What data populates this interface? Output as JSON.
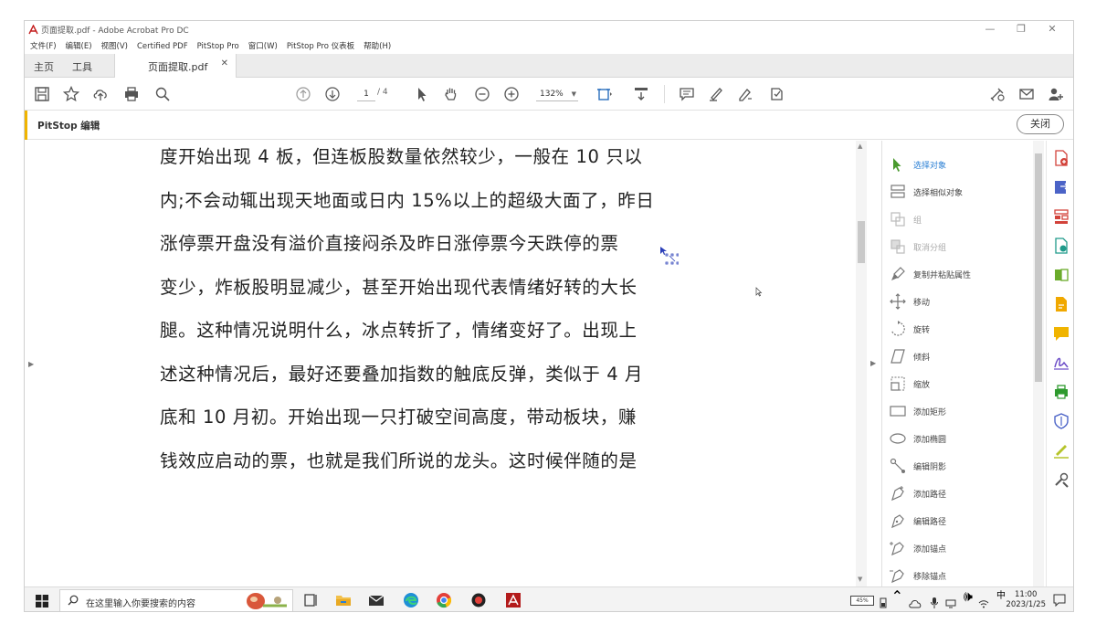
{
  "window": {
    "title": "页面提取.pdf - Adobe Acrobat Pro DC",
    "controls": [
      "—",
      "❐",
      "✕"
    ]
  },
  "menubar": [
    "文件(F)",
    "编辑(E)",
    "视图(V)",
    "Certified PDF",
    "PitStop Pro",
    "窗口(W)",
    "PitStop Pro 仪表板",
    "帮助(H)"
  ],
  "tabs": {
    "home": "主页",
    "tools": "工具",
    "document": "页面提取.pdf",
    "close": "✕"
  },
  "toolbar": {
    "page_current": "1",
    "page_total": "/ 4",
    "zoom": "132%"
  },
  "pitstop": {
    "label": "PitStop 编辑",
    "close_button": "关闭"
  },
  "document": {
    "lines": [
      "度开始出现 4 板，但连板股数量依然较少，一般在 10 只以",
      "内;不会动辄出现天地面或日内 15%以上的超级大面了，昨日",
      "涨停票开盘没有溢价直接闷杀及昨日涨停票今天跌停的票",
      "变少，炸板股明显减少，甚至开始出现代表情绪好转的大长",
      "腿。这种情况说明什么，冰点转折了，情绪变好了。出现上",
      "述这种情况后，最好还要叠加指数的触底反弹，类似于 4 月",
      "底和 10 月初。开始出现一只打破空间高度，带动板块，赚",
      "钱效应启动的票，也就是我们所说的龙头。这时候伴随的是"
    ]
  },
  "tool_panel": {
    "items": [
      {
        "label": "选择对象",
        "icon": "select-object-icon",
        "state": "active"
      },
      {
        "label": "选择相似对象",
        "icon": "select-similar-icon",
        "state": "normal"
      },
      {
        "label": "组",
        "icon": "group-icon",
        "state": "disabled"
      },
      {
        "label": "取消分组",
        "icon": "ungroup-icon",
        "state": "disabled"
      },
      {
        "label": "复制并粘贴属性",
        "icon": "brush-icon",
        "state": "normal"
      },
      {
        "label": "移动",
        "icon": "move-icon",
        "state": "normal"
      },
      {
        "label": "旋转",
        "icon": "rotate-icon",
        "state": "normal"
      },
      {
        "label": "倾斜",
        "icon": "skew-icon",
        "state": "normal"
      },
      {
        "label": "缩放",
        "icon": "scale-icon",
        "state": "normal"
      },
      {
        "label": "添加矩形",
        "icon": "rectangle-icon",
        "state": "normal"
      },
      {
        "label": "添加椭圆",
        "icon": "ellipse-icon",
        "state": "normal"
      },
      {
        "label": "编辑阴影",
        "icon": "shadow-icon",
        "state": "normal"
      },
      {
        "label": "添加路径",
        "icon": "pen-add-icon",
        "state": "normal"
      },
      {
        "label": "编辑路径",
        "icon": "pen-edit-icon",
        "state": "normal"
      },
      {
        "label": "添加锚点",
        "icon": "anchor-add-icon",
        "state": "normal"
      },
      {
        "label": "移除锚点",
        "icon": "anchor-remove-icon",
        "state": "normal"
      }
    ]
  },
  "taskbar": {
    "search_placeholder": "在这里输入你要搜索的内容",
    "battery": "45%",
    "ime": "中",
    "time": "11:00",
    "date": "2023/1/25"
  },
  "colors": {
    "accent_yellow": "#f0b400",
    "active_blue": "#2a7fd4",
    "adobe_red": "#c41e1e"
  }
}
